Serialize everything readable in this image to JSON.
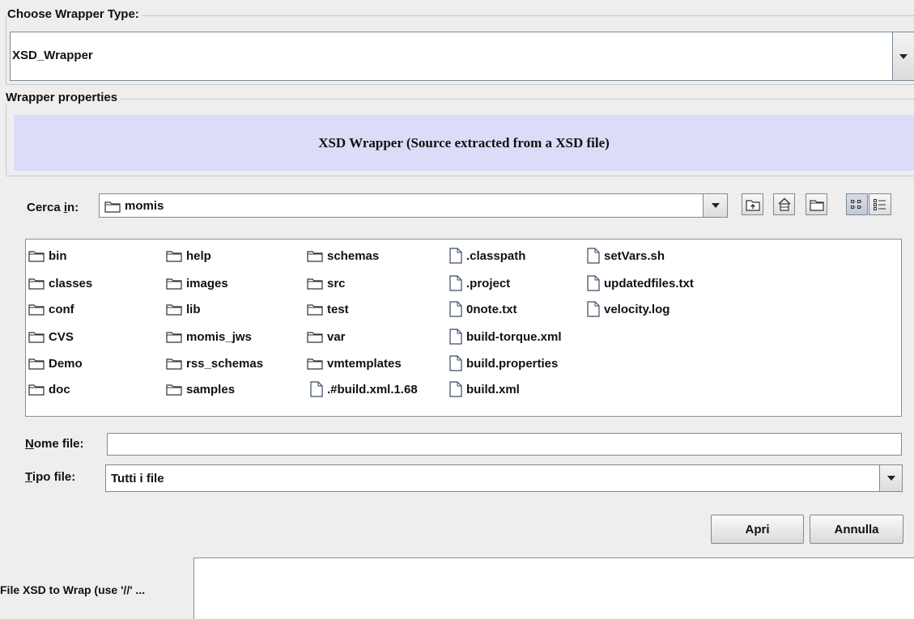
{
  "wrapper_type": {
    "legend": "Choose Wrapper Type:",
    "selected": "XSD_Wrapper"
  },
  "properties": {
    "legend": "Wrapper properties",
    "banner": "XSD Wrapper (Source extracted from a XSD file)"
  },
  "chooser": {
    "look_in_prefix": "Cerca ",
    "look_in_mnemonic": "i",
    "look_in_suffix": "n:",
    "current_folder": "momis",
    "toolbar_icons": [
      "up-folder-icon",
      "home-icon",
      "new-folder-icon",
      "list-view-icon",
      "details-view-icon"
    ],
    "folders": [
      "bin",
      "classes",
      "conf",
      "CVS",
      "Demo",
      "doc",
      "help",
      "images",
      "lib",
      "momis_jws",
      "rss_schemas",
      "samples",
      "schemas",
      "src",
      "test",
      "var",
      "vmtemplates"
    ],
    "files": [
      ".#build.xml.1.68",
      ".classpath",
      ".project",
      "0note.txt",
      "build-torque.xml",
      "build.properties",
      "build.xml",
      "setVars.sh",
      "updatedfiles.txt",
      "velocity.log"
    ],
    "filename_label_mnemonic": "N",
    "filename_label_rest": "ome file:",
    "filename_value": "",
    "filetype_label_mnemonic": "T",
    "filetype_label_rest": "ipo file:",
    "filetype_selected": "Tutti i file",
    "open_button": "Apri",
    "cancel_button": "Annulla"
  },
  "xsd_field": {
    "label": "File XSD to Wrap (use '//' ...",
    "value": ""
  }
}
